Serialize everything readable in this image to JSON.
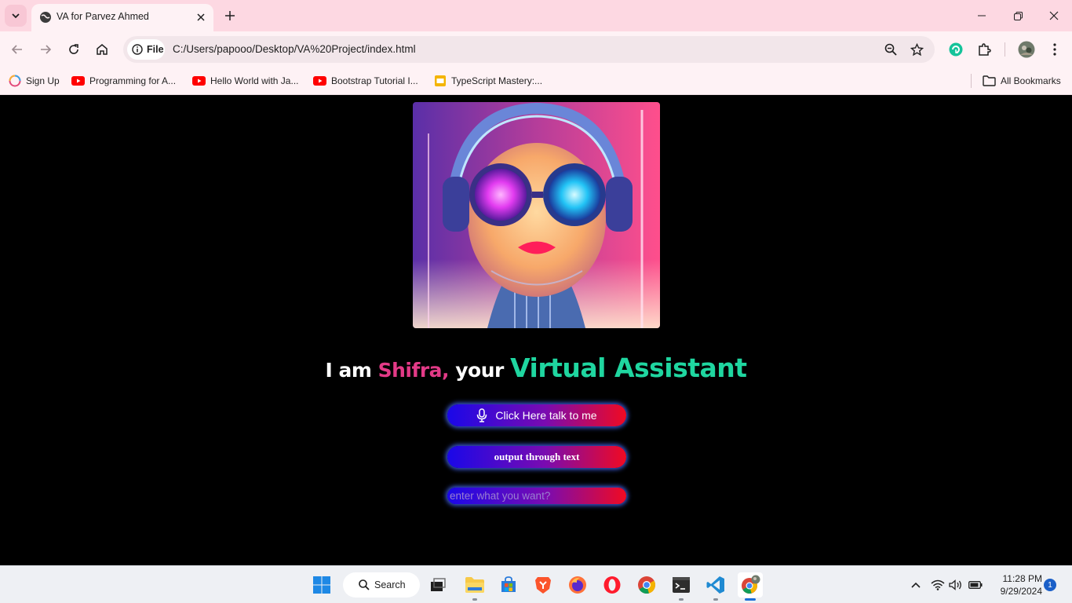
{
  "browser": {
    "tab": {
      "title": "VA for Parvez Ahmed"
    },
    "address_bar": {
      "site_chip_label": "File",
      "url": "C:/Users/papooo/Desktop/VA%20Project/index.html"
    },
    "bookmarks": [
      {
        "label": "Sign Up",
        "icon": "circle-logo-icon"
      },
      {
        "label": "Programming for A...",
        "icon": "youtube-icon"
      },
      {
        "label": "Hello World with Ja...",
        "icon": "youtube-icon"
      },
      {
        "label": "Bootstrap Tutorial I...",
        "icon": "youtube-icon"
      },
      {
        "label": "TypeScript Mastery:...",
        "icon": "slides-icon"
      }
    ],
    "all_bookmarks_label": "All Bookmarks"
  },
  "page": {
    "headline": {
      "part1": "I am ",
      "name": "Shifra,",
      "part2": " your ",
      "role": "Virtual Assistant"
    },
    "talk_button_label": "Click Here talk to me",
    "text_button_label": "output through text",
    "text_input_placeholder": "enter what you want?",
    "colors": {
      "name": "#e33a87",
      "role": "#1fd6a0",
      "button_start": "#1a08e8",
      "button_end": "#f00a22"
    }
  },
  "taskbar": {
    "search_label": "Search",
    "time": "11:28 PM",
    "date": "9/29/2024",
    "notification_count": "1"
  }
}
